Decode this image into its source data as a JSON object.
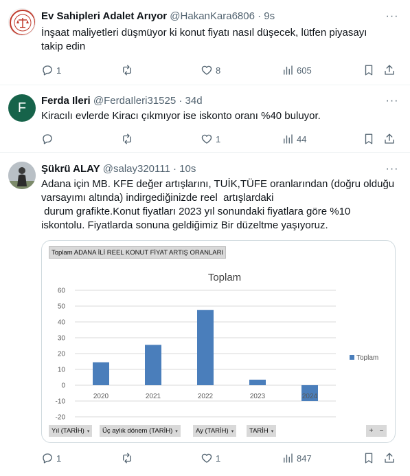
{
  "tweets": [
    {
      "author": "Ev Sahipleri Adalet Arıyor",
      "handle": "@HakanKara6806",
      "separator": "·",
      "time": "9s",
      "text_lines": [
        "İnşaat maliyetleri düşmüyor ki konut fiyatı nasıl düşecek, lütfen piyasayı",
        "takip edin"
      ],
      "replies": "1",
      "retweets": "",
      "likes": "8",
      "views": "605"
    },
    {
      "author": "Ferda Ileri",
      "handle": "@FerdaIleri31525",
      "separator": "·",
      "time": "34d",
      "avatar_letter": "F",
      "avatar_color": "#16634a",
      "text_lines": [
        "Kiracılı evlerde Kiracı çıkmıyor ise iskonto oranı %40 buluyor."
      ],
      "replies": "",
      "retweets": "",
      "likes": "1",
      "views": "44"
    },
    {
      "author": "Şükrü ALAY",
      "handle": "@salay320111",
      "separator": "·",
      "time": "10s",
      "text_lines": [
        "Adana için MB. KFE değer artışlarını, TUİK,TÜFE oranlarından (doğru olduğu",
        "varsayımı altında) indirgediğinizde reel  artışlardaki",
        " durum grafikte.Konut fiyatları 2023 yıl sonundaki fiyatlara göre %10",
        "iskontolu. Fiyatlarda sonuna geldiğimiz Bir düzeltme yaşıyoruz."
      ],
      "replies": "1",
      "retweets": "",
      "likes": "1",
      "views": "847"
    }
  ],
  "media": {
    "header_label": "Toplam ADANA İLİ REEL KONUT FİYAT ARTIŞ ORANLARI",
    "pivot_fields": [
      "Yıl (TARİH)",
      "Üç aylık dönem (TARİH)",
      "Ay (TARİH)",
      "TARİH"
    ],
    "zoom_in": "+",
    "zoom_out": "−"
  },
  "chart_data": {
    "type": "bar",
    "title": "Toplam",
    "categories": [
      "2020",
      "2021",
      "2022",
      "2023",
      "2024"
    ],
    "series": [
      {
        "name": "Toplam",
        "values": [
          14.5,
          25.5,
          47.5,
          3.5,
          -10
        ],
        "color": "#4a7ebb"
      }
    ],
    "y_ticks": [
      60,
      50,
      40,
      30,
      20,
      10,
      0,
      -10,
      -20
    ],
    "ylim": [
      -20,
      60
    ],
    "grid": true,
    "legend": "right"
  }
}
